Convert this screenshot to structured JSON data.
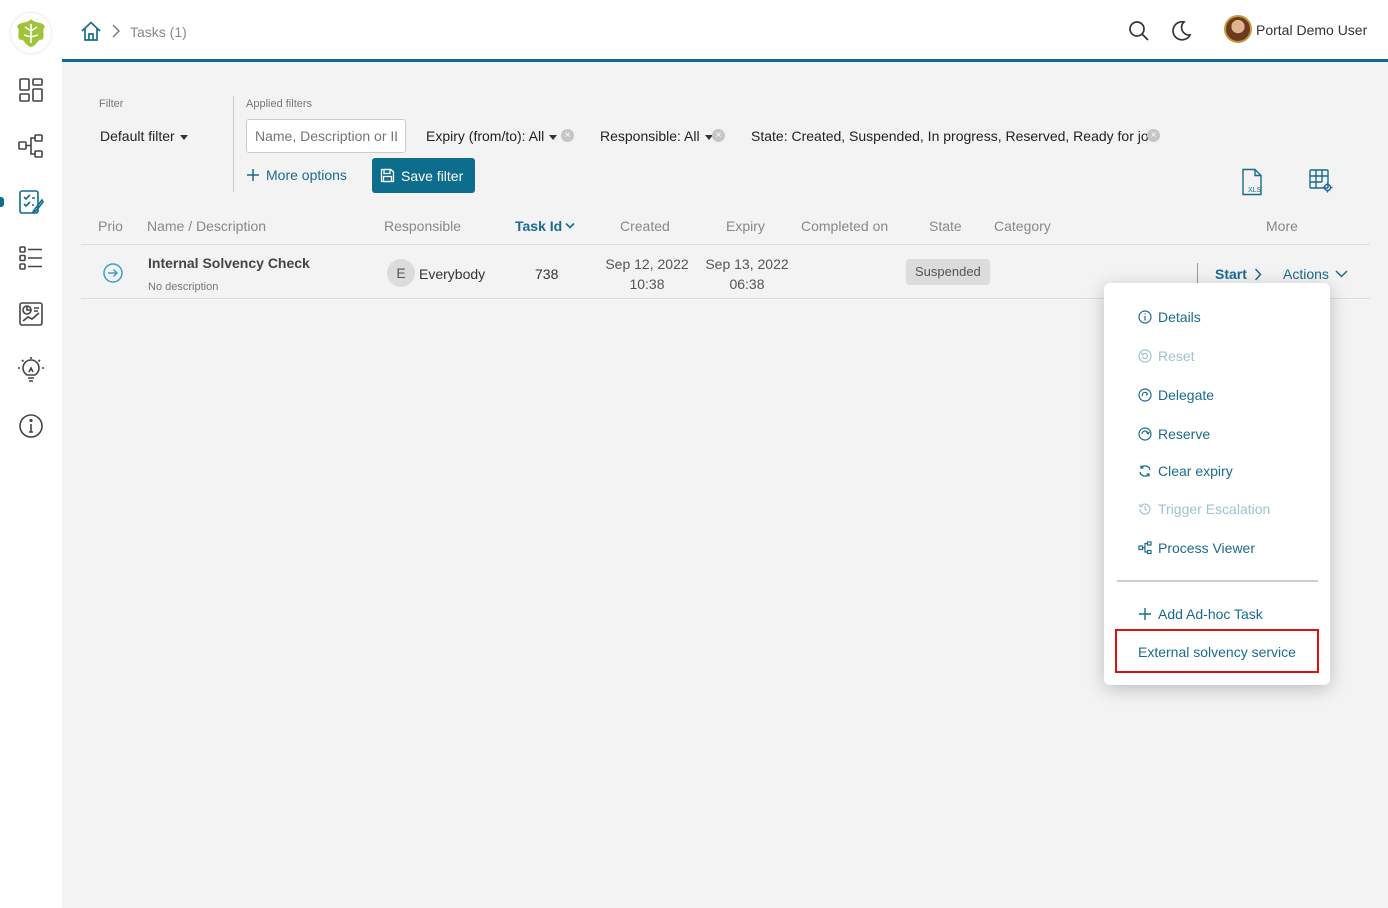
{
  "breadcrumb": {
    "current": "Tasks (1)"
  },
  "header": {
    "user_name": "Portal Demo User"
  },
  "filter": {
    "filter_label": "Filter",
    "default_filter": "Default filter",
    "applied_label": "Applied filters",
    "search_placeholder": "Name, Description or ID",
    "chips": {
      "expiry": "Expiry (from/to): All",
      "responsible": "Responsible: All",
      "state": "State: Created, Suspended, In progress, Reserved, Ready for jo"
    },
    "more_options": "More options",
    "save_filter": "Save filter"
  },
  "table": {
    "headers": {
      "prio": "Prio",
      "name": "Name / Description",
      "responsible": "Responsible",
      "task_id": "Task Id",
      "created": "Created",
      "expiry": "Expiry",
      "completed": "Completed on",
      "state": "State",
      "category": "Category",
      "more": "More"
    },
    "row": {
      "name": "Internal Solvency Check",
      "description": "No description",
      "responsible_initial": "E",
      "responsible": "Everybody",
      "task_id": "738",
      "created_date": "Sep 12, 2022",
      "created_time": "10:38",
      "expiry_date": "Sep 13, 2022",
      "expiry_time": "06:38",
      "state": "Suspended",
      "start": "Start",
      "actions": "Actions"
    }
  },
  "menu": {
    "details": "Details",
    "reset": "Reset",
    "delegate": "Delegate",
    "reserve": "Reserve",
    "clear_expiry": "Clear expiry",
    "trigger_escalation": "Trigger Escalation",
    "process_viewer": "Process Viewer",
    "add_adhoc": "Add Ad-hoc Task",
    "external_solvency": "External solvency service"
  },
  "colors": {
    "primary": "#0d6d8c",
    "link": "#1a6b8f",
    "highlight": "#e01010",
    "badge": "#dcdcdc"
  },
  "icons": [
    "logo-icon",
    "dashboard-icon",
    "process-icon",
    "task-list-icon",
    "case-list-icon",
    "statistics-icon",
    "idea-icon",
    "info-icon",
    "home-icon",
    "search-icon",
    "moon-icon",
    "xls-icon",
    "column-settings-icon"
  ]
}
